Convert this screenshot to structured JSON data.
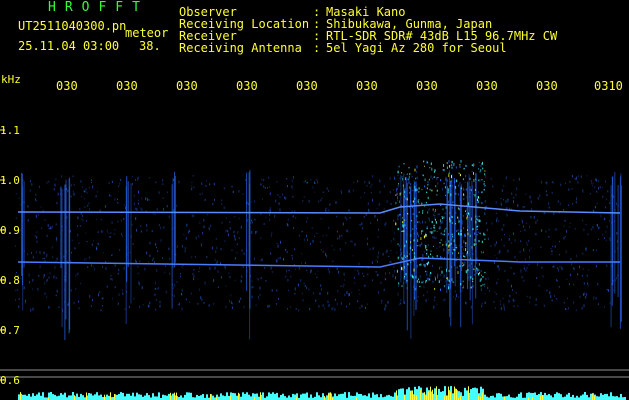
{
  "logo": "HROFFT",
  "file_name": "UT2511040300.pn",
  "meteor_label": "meteor",
  "timestamp": "25.11.04 03:00",
  "meteor_count": "38.",
  "info": [
    {
      "label": "Observer",
      "sep": ":",
      "value": "Masaki Kano"
    },
    {
      "label": "Receiving Location",
      "sep": ":",
      "value": "Shibukawa, Gunma, Japan"
    },
    {
      "label": "Receiver",
      "sep": ":",
      "value": "RTL-SDR SDR# 43dB L15 96.7MHz CW"
    },
    {
      "label": "Receiving Antenna",
      "sep": ":",
      "value": "5el Yagi Az 280 for Seoul"
    }
  ],
  "freq_unit": "kHz",
  "freq_ticks": [
    "1.1",
    "1.0",
    "0.9",
    "0.8",
    "0.7",
    "0.6"
  ],
  "time_ticks": [
    "030",
    "030",
    "030",
    "030",
    "030",
    "030",
    "030",
    "030",
    "030",
    "0310"
  ],
  "colors": {
    "text_yellow": "#ffff33",
    "text_green": "#33ff33",
    "echo_blue": "#2a6cff",
    "echo_cyan": "#44ffff",
    "echo_yellow": "#ffff40"
  }
}
